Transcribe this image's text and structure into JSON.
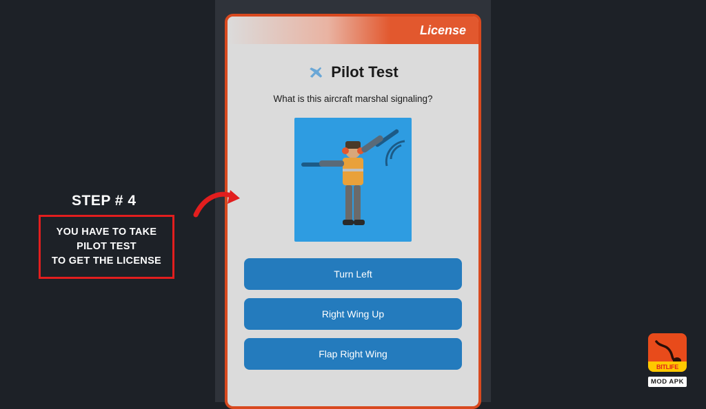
{
  "callout": {
    "step_label": "STEP # 4",
    "line1": "YOU HAVE TO TAKE",
    "line2": "PILOT TEST",
    "line3": "TO GET THE LICENSE"
  },
  "dialog": {
    "header": "License",
    "title": "Pilot Test",
    "question": "What is this aircraft marshal signaling?",
    "answers": [
      "Turn Left",
      "Right Wing Up",
      "Flap Right Wing"
    ]
  },
  "app_badge": {
    "name": "BITLIFE",
    "sub": "MOD APK"
  },
  "icons": {
    "plane": "airplane-icon",
    "arrow": "curved-arrow-icon",
    "marshal": "aircraft-marshal-figure"
  },
  "colors": {
    "bg": "#1d2127",
    "accent_red": "#e21e1e",
    "dialog_border": "#d8491f",
    "button_blue": "#247bbd",
    "image_blue": "#2e9ce1",
    "badge_orange": "#e84b1b",
    "badge_yellow": "#ffc800"
  }
}
